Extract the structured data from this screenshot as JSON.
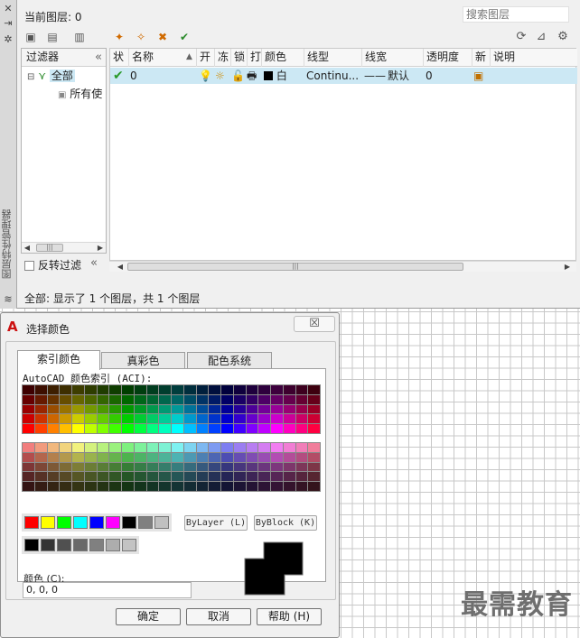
{
  "layer_palette": {
    "side_title": "图层特性管理器",
    "current_layer_label": "当前图层: 0",
    "search_placeholder": "搜索图层",
    "filter_header": "过滤器",
    "tree": [
      "全部",
      "所有使"
    ],
    "reverse_filter": "反转过滤",
    "columns": [
      "状",
      "名称",
      "开",
      "冻",
      "锁",
      "打",
      "颜色",
      "线型",
      "线宽",
      "透明度",
      "新",
      "说明"
    ],
    "row": {
      "status": "✔",
      "name": "0",
      "color_name": "白",
      "linetype": "Continu...",
      "lineweight_dash": "——",
      "lineweight": "默认",
      "transparency": "0"
    },
    "status": "全部: 显示了 1 个图层，共 1 个图层"
  },
  "color_dialog": {
    "title": "选择颜色",
    "close": "☒",
    "tabs": [
      "索引颜色",
      "真彩色",
      "配色系统"
    ],
    "aci_label": "AutoCAD 颜色索引 (ACI):",
    "bylayer": "ByLayer (L)",
    "byblock": "ByBlock (K)",
    "color_label": "颜色 (C):",
    "color_value": "0, 0, 0",
    "buttons": {
      "ok": "确定",
      "cancel": "取消",
      "help": "帮助 (H)"
    },
    "standard_colors": [
      "#ff0000",
      "#ffff00",
      "#00ff00",
      "#00ffff",
      "#0000ff",
      "#ff00ff",
      "#000000",
      "#808080",
      "#c0c0c0"
    ],
    "grey_colors": [
      "#000000",
      "#333333",
      "#505050",
      "#696969",
      "#808080",
      "#adadad",
      "#c3c3c3"
    ],
    "selected_color": "#000000"
  },
  "watermark": "最需教育"
}
